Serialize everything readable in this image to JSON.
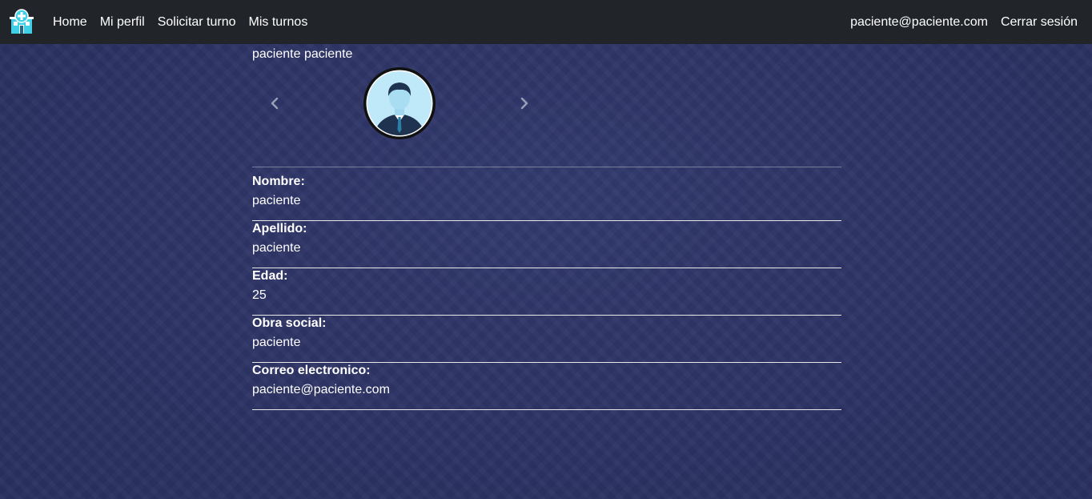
{
  "navbar": {
    "logo_icon": "hospital-icon",
    "links": {
      "home": "Home",
      "profile": "Mi perfil",
      "request_appointment": "Solicitar turno",
      "my_appointments": "Mis turnos"
    },
    "user_email": "paciente@paciente.com",
    "logout": "Cerrar sesión"
  },
  "profile": {
    "full_name": "paciente paciente",
    "carousel": {
      "prev_icon": "chevron-left-icon",
      "next_icon": "chevron-right-icon",
      "avatar_icon": "user-avatar-icon"
    },
    "fields": [
      {
        "label": "Nombre:",
        "value": "paciente"
      },
      {
        "label": "Apellido:",
        "value": "paciente"
      },
      {
        "label": "Edad:",
        "value": "25"
      },
      {
        "label": "Obra social:",
        "value": "paciente"
      },
      {
        "label": "Correo electronico:",
        "value": "paciente@paciente.com"
      }
    ]
  },
  "colors": {
    "navbar_bg": "#212529",
    "page_bg": "#2e3566",
    "text": "#ffffff",
    "logo_accent": "#3fd0e8"
  }
}
